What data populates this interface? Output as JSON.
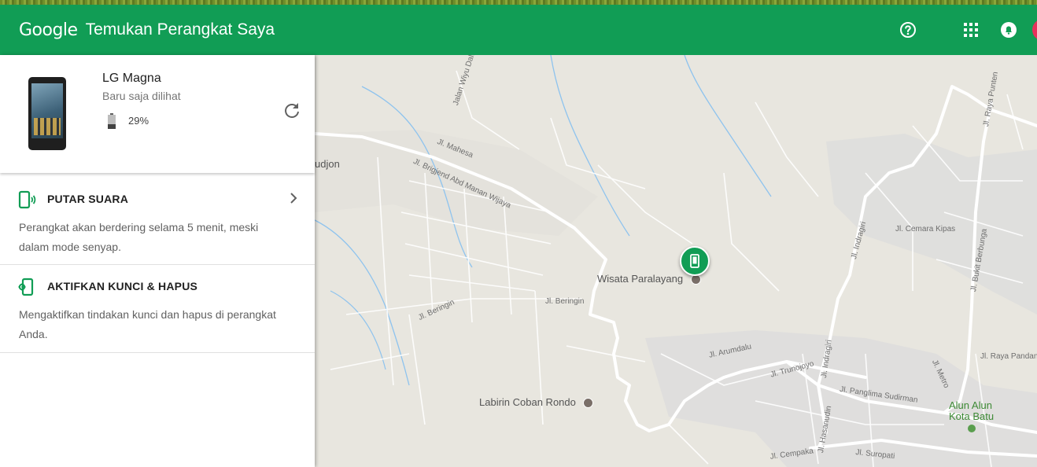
{
  "header": {
    "logo": "Google",
    "title": "Temukan Perangkat Saya",
    "icons": [
      "help-icon",
      "apps-grid-icon",
      "notifications-icon",
      "avatar"
    ],
    "color": "#119d55"
  },
  "device": {
    "name": "LG Magna",
    "last_seen": "Baru saja dilihat",
    "battery": "29%"
  },
  "actions": [
    {
      "title": "PUTAR SUARA",
      "desc": "Perangkat akan berdering selama 5 menit, meski dalam mode senyap.",
      "icon": "phone-ring-icon"
    },
    {
      "title": "AKTIFKAN KUNCI & HAPUS",
      "desc": "Mengaktifkan tindakan kunci dan hapus di perangkat Anda.",
      "icon": "phone-lock-icon"
    }
  ],
  "map": {
    "places": {
      "wisata": "Wisata Paralayang",
      "labirin": "Labirin Coban Rondo",
      "alun1": "Alun Alun",
      "alun2": "Kota Batu"
    },
    "streets": {
      "s1": "Jl. Mahesa",
      "s2": "Jl. Brigjend Abd Manan Wijaya",
      "s3": "Jl. Beringin",
      "s4": "Jl. Beringin",
      "s5": "Jl. Arumdalu",
      "s6": "Jl. Trunojoyo",
      "s7": "Jl. Panglima Sudirman",
      "s8": "Jl. Cemara Kipas",
      "s9": "Jl. Indragiri",
      "s10": "Jl. Indragiri",
      "s11": "Jl. Bukit Berbunga",
      "s12": "Jl. Raya Punten",
      "s13": "Jl. Raya Pandan",
      "s14": "Jl. Hasanudin",
      "s15": "Jl. Cempaka",
      "s16": "Jl. Suropati",
      "s17": "Jalan Wiyu Dali",
      "s18": "Jl. Metro",
      "s19": "udjon"
    }
  }
}
